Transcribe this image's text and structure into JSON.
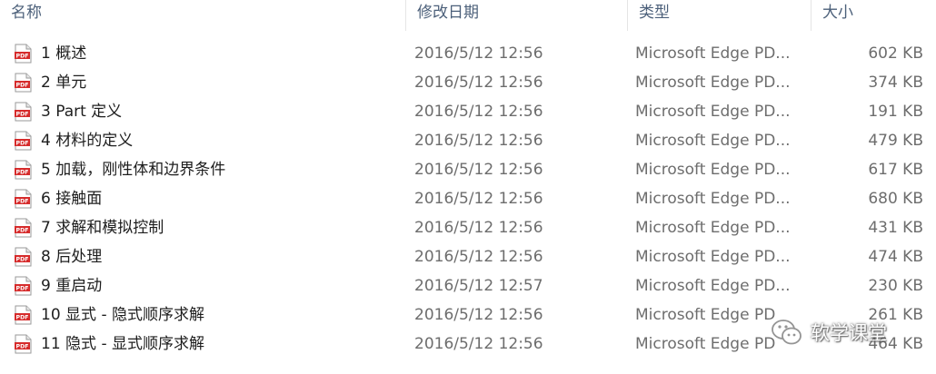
{
  "columns": {
    "name": "名称",
    "date": "修改日期",
    "type": "类型",
    "size": "大小"
  },
  "file_icon": "pdf-file-icon",
  "accent_color": "#d62b2b",
  "files": [
    {
      "name": "1 概述",
      "date": "2016/5/12 12:56",
      "type": "Microsoft Edge PD...",
      "size": "602 KB"
    },
    {
      "name": "2 单元",
      "date": "2016/5/12 12:56",
      "type": "Microsoft Edge PD...",
      "size": "374 KB"
    },
    {
      "name": "3 Part 定义",
      "date": "2016/5/12 12:56",
      "type": "Microsoft Edge PD...",
      "size": "191 KB"
    },
    {
      "name": "4 材料的定义",
      "date": "2016/5/12 12:56",
      "type": "Microsoft Edge PD...",
      "size": "479 KB"
    },
    {
      "name": "5 加载，刚性体和边界条件",
      "date": "2016/5/12 12:56",
      "type": "Microsoft Edge PD...",
      "size": "617 KB"
    },
    {
      "name": "6 接触面",
      "date": "2016/5/12 12:56",
      "type": "Microsoft Edge PD...",
      "size": "680 KB"
    },
    {
      "name": "7 求解和模拟控制",
      "date": "2016/5/12 12:56",
      "type": "Microsoft Edge PD...",
      "size": "431 KB"
    },
    {
      "name": "8 后处理",
      "date": "2016/5/12 12:56",
      "type": "Microsoft Edge PD...",
      "size": "474 KB"
    },
    {
      "name": "9 重启动",
      "date": "2016/5/12 12:57",
      "type": "Microsoft Edge PD...",
      "size": "230 KB"
    },
    {
      "name": "10 显式 - 隐式顺序求解",
      "date": "2016/5/12 12:56",
      "type": "Microsoft Edge PD",
      "size": "261 KB"
    },
    {
      "name": "11 隐式 - 显式顺序求解",
      "date": "2016/5/12 12:56",
      "type": "Microsoft Edge PD",
      "size": "464 KB"
    }
  ],
  "watermark": {
    "icon": "wechat-icon",
    "text": "软学课堂"
  }
}
